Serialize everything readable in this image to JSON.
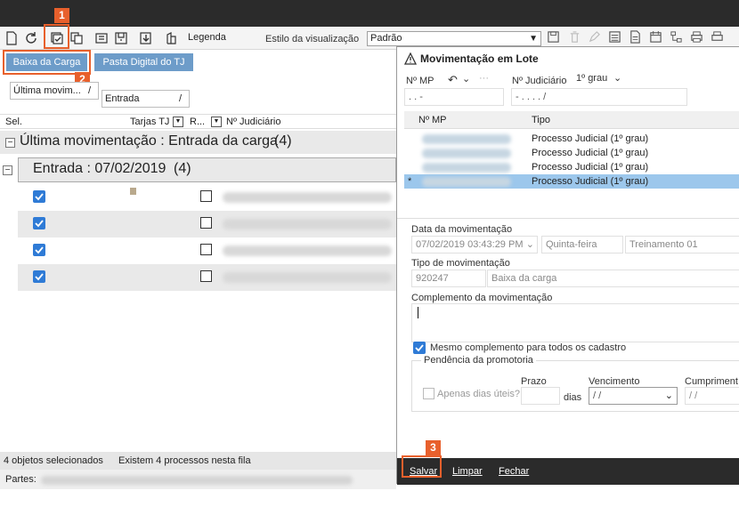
{
  "toolbar": {
    "legend_label": "Legenda",
    "view_style_label": "Estilo da visualização",
    "view_style_value": "Padrão"
  },
  "tabs": {
    "baixa_carga": "Baixa da Carga",
    "pasta_digital": "Pasta Digital do TJ"
  },
  "callouts": {
    "one": "1",
    "two": "2",
    "three": "3"
  },
  "grouping": {
    "box1": "Última movim...",
    "box1_sort": "/",
    "box2": "Entrada",
    "box2_sort": "/"
  },
  "columns": {
    "sel": "Sel.",
    "tarjas": "Tarjas TJ",
    "r": "R...",
    "judiciario": "Nº Judiciário"
  },
  "groups": {
    "level1": "Última movimentação : Entrada da carga",
    "level1_count": "(4)",
    "level2": "Entrada : 07/02/2019",
    "level2_count": "(4)"
  },
  "status": {
    "selected": "4 objetos selecionados",
    "queue": "Existem 4 processos nesta fila",
    "partes_label": "Partes:"
  },
  "dialog": {
    "title": "Movimentação em Lote",
    "mp_label": "Nº MP",
    "mp_value": ".  .     -",
    "judiciario_label": "Nº Judiciário",
    "grau_value": "1º grau",
    "judiciario_value": "-  .  .  .  .  /",
    "list_headers": {
      "mp": "Nº MP",
      "tipo": "Tipo"
    },
    "list_rows": [
      {
        "tipo": "Processo Judicial (1º grau)",
        "marker": ""
      },
      {
        "tipo": "Processo Judicial (1º grau)",
        "marker": ""
      },
      {
        "tipo": "Processo Judicial (1º grau)",
        "marker": ""
      },
      {
        "tipo": "Processo Judicial (1º grau)",
        "marker": "*"
      }
    ],
    "data_mov_label": "Data da movimentação",
    "data_mov_value": "07/02/2019 03:43:29 PM",
    "weekday_value": "Quinta-feira",
    "user_value": "Treinamento 01",
    "tipo_mov_label": "Tipo de movimentação",
    "tipo_mov_code": "920247",
    "tipo_mov_desc": "Baixa da carga",
    "complemento_label": "Complemento da movimentação",
    "same_complement_label": "Mesmo complemento para todos os cadastro",
    "pendencia_legend": "Pendência da promotoria",
    "apenas_uteis_label": "Apenas dias úteis?",
    "prazo_label": "Prazo",
    "dias_label": "dias",
    "vencimento_label": "Vencimento",
    "vencimento_value": "/  /",
    "cumprimento_label": "Cumpriment",
    "cumprimento_value": "/  /",
    "buttons": {
      "salvar": "Salvar",
      "limpar": "Limpar",
      "fechar": "Fechar"
    }
  }
}
